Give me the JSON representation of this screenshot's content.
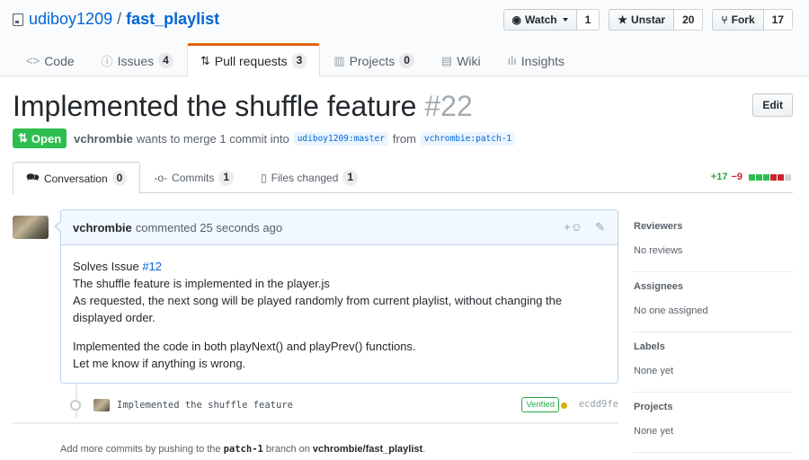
{
  "repo": {
    "owner": "udiboy1209",
    "separator": "/",
    "name": "fast_playlist"
  },
  "actions": {
    "watch_label": "Watch",
    "watch_count": "1",
    "star_label": "Unstar",
    "star_count": "20",
    "fork_label": "Fork",
    "fork_count": "17"
  },
  "nav": {
    "items": [
      {
        "label": "Code",
        "icon": "<>",
        "count": null
      },
      {
        "label": "Issues",
        "icon": "ⓘ",
        "count": "4"
      },
      {
        "label": "Pull requests",
        "icon": "⇅",
        "count": "3"
      },
      {
        "label": "Projects",
        "icon": "▥",
        "count": "0"
      },
      {
        "label": "Wiki",
        "icon": "▤",
        "count": null
      },
      {
        "label": "Insights",
        "icon": "ılı",
        "count": null
      }
    ]
  },
  "pr": {
    "title": "Implemented the shuffle feature",
    "number": "#22",
    "edit_label": "Edit",
    "state": "Open",
    "author": "vchrombie",
    "merge_text": "wants to merge 1 commit into",
    "base_ref": "udiboy1209:master",
    "from_text": "from",
    "head_ref": "vchrombie:patch-1"
  },
  "tabs": [
    {
      "label": "Conversation",
      "count": "0"
    },
    {
      "label": "Commits",
      "count": "1"
    },
    {
      "label": "Files changed",
      "count": "1"
    }
  ],
  "diffstat": {
    "additions": "+17",
    "deletions": "−9",
    "blocks": [
      "#2cbe4e",
      "#2cbe4e",
      "#2cbe4e",
      "#cb2431",
      "#cb2431"
    ]
  },
  "comment": {
    "author": "vchrombie",
    "meta": "commented 25 seconds ago",
    "body_line1_prefix": "Solves Issue ",
    "body_issue_link": "#12",
    "body_line2": "The shuffle feature is implemented in the player.js",
    "body_line3": "As requested, the next song will be played randomly from current playlist, without changing the displayed order.",
    "body_line4": "Implemented the code in both playNext() and playPrev() functions.",
    "body_line5": "Let me know if anything is wrong."
  },
  "commit": {
    "message": "Implemented the shuffle feature",
    "verified": "Verified",
    "sha": "ecdd9fe"
  },
  "footer": {
    "prefix": "Add more commits by pushing to the",
    "branch": "patch-1",
    "middle": "branch on",
    "repo": "vchrombie/fast_playlist",
    "suffix": "."
  },
  "sidebar": [
    {
      "heading": "Reviewers",
      "value": "No reviews"
    },
    {
      "heading": "Assignees",
      "value": "No one assigned"
    },
    {
      "heading": "Labels",
      "value": "None yet"
    },
    {
      "heading": "Projects",
      "value": "None yet"
    }
  ]
}
